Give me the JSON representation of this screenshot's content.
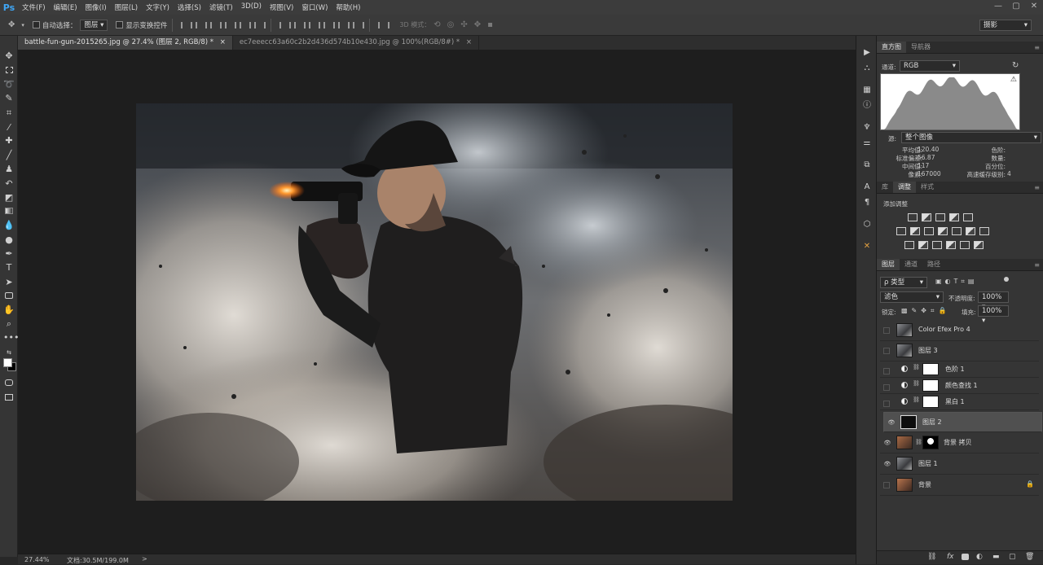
{
  "app": {
    "logo": "Ps"
  },
  "menu": [
    "文件(F)",
    "编辑(E)",
    "图像(I)",
    "图层(L)",
    "文字(Y)",
    "选择(S)",
    "滤镜(T)",
    "3D(D)",
    "视图(V)",
    "窗口(W)",
    "帮助(H)"
  ],
  "window_controls": [
    "—",
    "▢",
    "✕"
  ],
  "options": {
    "auto_select_label": "自动选择：",
    "auto_select_value": "图层",
    "show_transform_label": "显示变换控件",
    "mode_3d_label": "3D 模式：",
    "workspace": "摄影"
  },
  "tabs": [
    {
      "label": "battle-fun-gun-2015265.jpg @ 27.4% (图层 2, RGB/8) *",
      "close": "×"
    },
    {
      "label": "ec7eeecc63a60c2b2d436d574b10e430.jpg @ 100%(RGB/8#) *",
      "close": "×"
    }
  ],
  "status": {
    "zoom": "27.44%",
    "doc": "文档:30.5M/199.0M",
    "arrow": ">"
  },
  "histogram": {
    "tabs": [
      "直方图",
      "导航器"
    ],
    "channel_label": "通道:",
    "channel_value": "RGB",
    "source_label": "源:",
    "source_value": "整个图像",
    "stats_left": [
      {
        "k": "平均值:",
        "v": "120.40"
      },
      {
        "k": "标准偏差:",
        "v": "56.87"
      },
      {
        "k": "中间值:",
        "v": "117"
      },
      {
        "k": "像素:",
        "v": "167000"
      }
    ],
    "stats_right": [
      {
        "k": "色阶:",
        "v": ""
      },
      {
        "k": "数量:",
        "v": ""
      },
      {
        "k": "百分位:",
        "v": ""
      },
      {
        "k": "高速缓存级别:",
        "v": "4"
      }
    ]
  },
  "adjust": {
    "tabs": [
      "库",
      "调整",
      "样式"
    ],
    "title": "添加调整"
  },
  "layers_panel": {
    "tabs": [
      "图层",
      "通道",
      "路径"
    ],
    "filter_value": "ρ 类型",
    "blend_mode": "滤色",
    "opacity_label": "不透明度:",
    "opacity_value": "100%",
    "lock_label": "锁定:",
    "fill_label": "填充:",
    "fill_value": "100%",
    "footer_icons": [
      "link-icon",
      "fx",
      "mask-icon",
      "adjustment-icon",
      "folder-icon",
      "new-layer-icon",
      "trash-icon"
    ],
    "fx_label": "fx"
  },
  "layers": [
    {
      "name": "Color Efex Pro 4",
      "visible": false,
      "type": "image",
      "selected": false
    },
    {
      "name": "图层 3",
      "visible": false,
      "type": "image",
      "selected": false
    },
    {
      "name": "色阶 1",
      "visible": false,
      "type": "adjust",
      "selected": false
    },
    {
      "name": "颜色查找 1",
      "visible": false,
      "type": "adjust",
      "selected": false
    },
    {
      "name": "黑白 1",
      "visible": false,
      "type": "adjust",
      "selected": false
    },
    {
      "name": "图层 2",
      "visible": true,
      "type": "dark",
      "selected": true
    },
    {
      "name": "背景 拷贝",
      "visible": true,
      "type": "masked",
      "selected": false
    },
    {
      "name": "图层 1",
      "visible": true,
      "type": "image",
      "selected": false
    },
    {
      "name": "背景",
      "visible": false,
      "type": "bg",
      "selected": false,
      "locked": true
    }
  ]
}
